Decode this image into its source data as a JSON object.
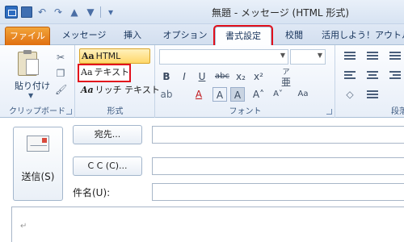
{
  "window": {
    "title": "無題 - メッセージ (HTML 形式)"
  },
  "tabs": [
    {
      "label": "ファイル"
    },
    {
      "label": "メッセージ"
    },
    {
      "label": "挿入"
    },
    {
      "label": "オプション"
    },
    {
      "label": "書式設定"
    },
    {
      "label": "校閲"
    },
    {
      "label": "活用しよう！アウトル"
    }
  ],
  "ribbon": {
    "clipboard": {
      "paste_label": "貼り付け",
      "group_label": "クリップボード"
    },
    "format": {
      "html_label": "HTML",
      "text_label": "テキスト",
      "rich_label": "リッチ テキスト",
      "aa": "Aa",
      "group_label": "形式"
    },
    "font": {
      "group_label": "フォント",
      "bold": "B",
      "italic": "I",
      "underline": "U",
      "strike": "abc",
      "subscript": "x₂",
      "superscript": "x²",
      "ruby": "亜",
      "ruby_top": "ア",
      "char_border": "A",
      "char_shade": "A",
      "grow": "A˄",
      "shrink": "A˅",
      "clear": "Aa"
    },
    "paragraph": {
      "group_label": "段落"
    }
  },
  "header": {
    "send_label": "送信(S)",
    "to_label": "宛先...",
    "cc_label": "C C (C)...",
    "subject_label": "件名(U):"
  },
  "body": {
    "paragraph_mark": "↵"
  },
  "colors": {
    "highlight_box": "#e2101c",
    "file_tab": "#e06f10",
    "selected_format": "#ffd76a"
  }
}
